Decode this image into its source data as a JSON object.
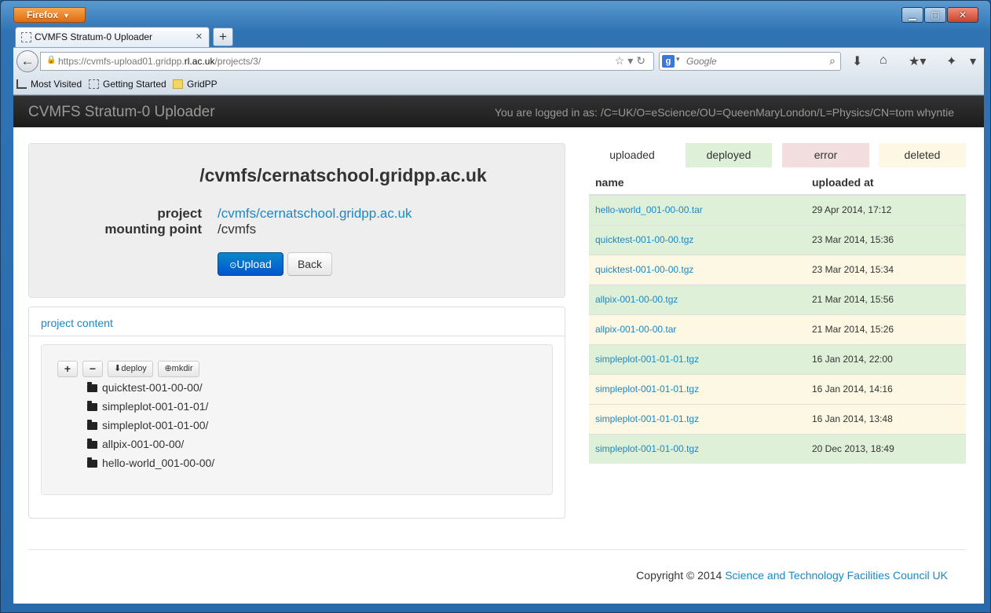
{
  "browser": {
    "app_button": "Firefox",
    "tab_title": "CVMFS Stratum-0 Uploader",
    "url_prefix": "https://cvmfs-upload01.gridpp.",
    "url_host": "rl.ac.uk",
    "url_path": "/projects/3/",
    "search_placeholder": "Google",
    "bookmarks": [
      "Most Visited",
      "Getting Started",
      "GridPP"
    ]
  },
  "app": {
    "brand": "CVMFS Stratum-0 Uploader",
    "logged_in": "You are logged in as: /C=UK/O=eScience/OU=QueenMaryLondon/L=Physics/CN=tom whyntie"
  },
  "project": {
    "title": "/cvmfs/cernatschool.gridpp.ac.uk",
    "project_label": "project",
    "project_value": "/cvmfs/cernatschool.gridpp.ac.uk",
    "mount_label": "mounting point",
    "mount_value": "/cvmfs",
    "upload_button": "Upload",
    "back_button": "Back"
  },
  "content_panel": {
    "heading": "project content",
    "toolbar": {
      "expand": "+",
      "collapse": "−",
      "deploy": "deploy",
      "mkdir": "mkdir"
    },
    "folders": [
      "quicktest-001-00-00/",
      "simpleplot-001-01-01/",
      "simpleplot-001-01-00/",
      "allpix-001-00-00/",
      "hello-world_001-00-00/"
    ]
  },
  "status_tabs": {
    "uploaded": "uploaded",
    "deployed": "deployed",
    "error": "error",
    "deleted": "deleted"
  },
  "files_table": {
    "headers": {
      "name": "name",
      "uploaded_at": "uploaded at"
    },
    "rows": [
      {
        "name": "hello-world_001-00-00.tar",
        "uploaded_at": "29 Apr 2014, 17:12",
        "status": "deployed"
      },
      {
        "name": "quicktest-001-00-00.tgz",
        "uploaded_at": "23 Mar 2014, 15:36",
        "status": "deployed"
      },
      {
        "name": "quicktest-001-00-00.tgz",
        "uploaded_at": "23 Mar 2014, 15:34",
        "status": "deleted"
      },
      {
        "name": "allpix-001-00-00.tgz",
        "uploaded_at": "21 Mar 2014, 15:56",
        "status": "deployed"
      },
      {
        "name": "allpix-001-00-00.tar",
        "uploaded_at": "21 Mar 2014, 15:26",
        "status": "deleted"
      },
      {
        "name": "simpleplot-001-01-01.tgz",
        "uploaded_at": "16 Jan 2014, 22:00",
        "status": "deployed"
      },
      {
        "name": "simpleplot-001-01-01.tgz",
        "uploaded_at": "16 Jan 2014, 14:16",
        "status": "deleted"
      },
      {
        "name": "simpleplot-001-01-01.tgz",
        "uploaded_at": "16 Jan 2014, 13:48",
        "status": "deleted"
      },
      {
        "name": "simpleplot-001-01-00.tgz",
        "uploaded_at": "20 Dec 2013, 18:49",
        "status": "deployed"
      }
    ]
  },
  "footer": {
    "copyright": "Copyright © 2014",
    "org_link": "Science and Technology Facilities Council UK"
  },
  "colors": {
    "link": "#1a88c9",
    "deployed_bg": "#dff0d8",
    "error_bg": "#f2dede",
    "deleted_bg": "#fcf8e3",
    "navbar_bg": "#222222",
    "primary_button": "#0066cc"
  },
  "icons": {
    "folder": "folder-icon",
    "upload": "upload-icon",
    "deploy": "download-icon",
    "mkdir": "plus-circle-icon"
  }
}
